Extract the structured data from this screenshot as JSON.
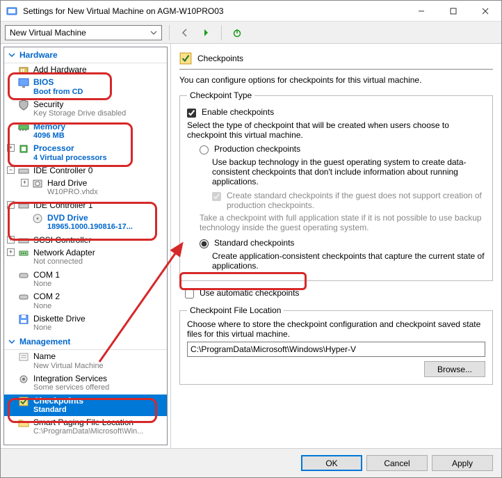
{
  "window": {
    "title": "Settings for New Virtual Machine on AGM-W10PRO03"
  },
  "toolbar": {
    "vm_name": "New Virtual Machine"
  },
  "sidebar": {
    "hardware_label": "Hardware",
    "management_label": "Management",
    "items": {
      "add_hardware": {
        "label": "Add Hardware"
      },
      "bios": {
        "label": "BIOS",
        "subtext": "Boot from CD"
      },
      "security": {
        "label": "Security",
        "subtext": "Key Storage Drive disabled"
      },
      "memory": {
        "label": "Memory",
        "subtext": "4096 MB"
      },
      "processor": {
        "label": "Processor",
        "subtext": "4 Virtual processors"
      },
      "ide0": {
        "label": "IDE Controller 0"
      },
      "hard_drive": {
        "label": "Hard Drive",
        "subtext": "W10PRO.vhdx"
      },
      "ide1": {
        "label": "IDE Controller 1"
      },
      "dvd": {
        "label": "DVD Drive",
        "subtext": "18965.1000.190816-17..."
      },
      "scsi": {
        "label": "SCSI Controller"
      },
      "netadapter": {
        "label": "Network Adapter",
        "subtext": "Not connected"
      },
      "com1": {
        "label": "COM 1",
        "subtext": "None"
      },
      "com2": {
        "label": "COM 2",
        "subtext": "None"
      },
      "diskette": {
        "label": "Diskette Drive",
        "subtext": "None"
      },
      "name": {
        "label": "Name",
        "subtext": "New Virtual Machine"
      },
      "integ": {
        "label": "Integration Services",
        "subtext": "Some services offered"
      },
      "checkpoints": {
        "label": "Checkpoints",
        "subtext": "Standard"
      },
      "smartpaging": {
        "label": "Smart Paging File Location",
        "subtext": "C:\\ProgramData\\Microsoft\\Win..."
      }
    }
  },
  "content": {
    "panel_title": "Checkpoints",
    "intro": "You can configure options for checkpoints for this virtual machine.",
    "type_legend": "Checkpoint Type",
    "enable_label": "Enable checkpoints",
    "select_type_text": "Select the type of checkpoint that will be created when users choose to checkpoint this virtual machine.",
    "production_label": "Production checkpoints",
    "production_desc": "Use backup technology in the guest operating system to create data-consistent checkpoints that don't include information about running applications.",
    "create_std_label": "Create standard checkpoints if the guest does not support creation of production checkpoints.",
    "fallback_note": "Take a checkpoint with full application state if it is not possible to use backup technology inside the guest operating system.",
    "standard_label": "Standard checkpoints",
    "standard_desc": "Create application-consistent checkpoints that capture the current state of applications.",
    "auto_label": "Use automatic checkpoints",
    "loc_legend": "Checkpoint File Location",
    "loc_desc": "Choose where to store the checkpoint configuration and checkpoint saved state files for this virtual machine.",
    "loc_path": "C:\\ProgramData\\Microsoft\\Windows\\Hyper-V",
    "browse": "Browse..."
  },
  "buttons": {
    "ok": "OK",
    "cancel": "Cancel",
    "apply": "Apply"
  }
}
